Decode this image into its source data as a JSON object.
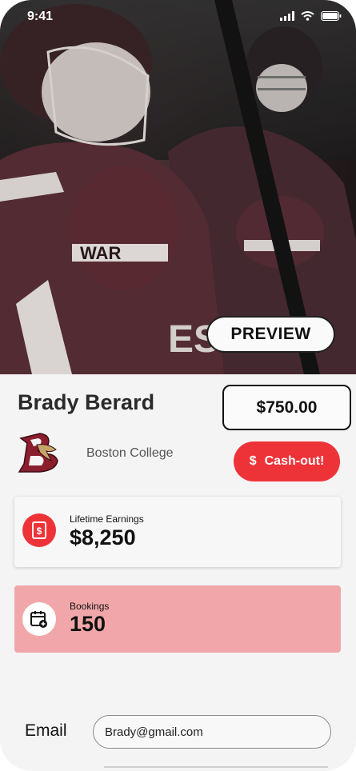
{
  "status_bar": {
    "time": "9:41"
  },
  "hero": {
    "preview_label": "PREVIEW"
  },
  "profile": {
    "name": "Brady Berard",
    "balance": "$750.00",
    "school": "Boston College",
    "cashout_icon": "$",
    "cashout_label": "Cash-out!"
  },
  "stats": {
    "earnings": {
      "label": "Lifetime Earnings",
      "value": "$8,250",
      "icon": "dollar-bill-icon"
    },
    "bookings": {
      "label": "Bookings",
      "value": "150",
      "icon": "calendar-add-icon"
    }
  },
  "form": {
    "email_label": "Email",
    "email_value": "Brady@gmail.com"
  },
  "colors": {
    "accent": "#ee3338",
    "bookings_bg": "#f1a7a9",
    "maroon": "#8b1e2d"
  }
}
